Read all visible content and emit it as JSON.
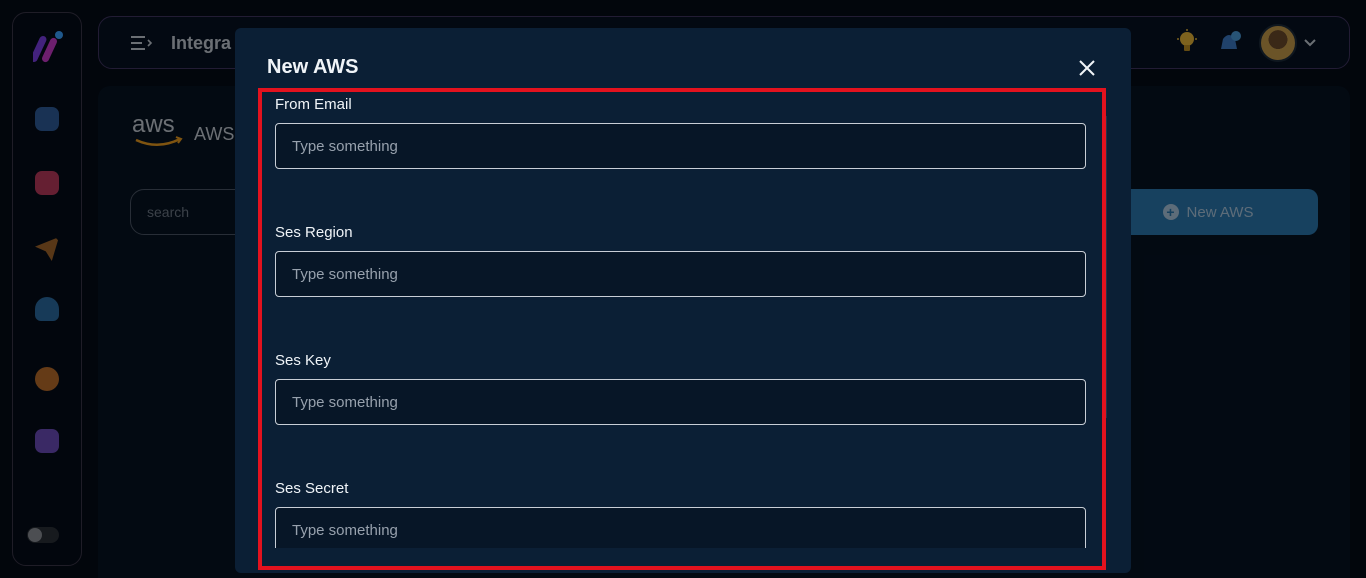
{
  "topbar": {
    "title": "Integra"
  },
  "page": {
    "brand_label": "AWS"
  },
  "search": {
    "placeholder": "search"
  },
  "actions": {
    "new_aws_label": "New AWS"
  },
  "modal": {
    "title": "New AWS",
    "fields": [
      {
        "label": "From Email",
        "placeholder": "Type something",
        "value": ""
      },
      {
        "label": "Ses Region",
        "placeholder": "Type something",
        "value": ""
      },
      {
        "label": "Ses Key",
        "placeholder": "Type something",
        "value": ""
      },
      {
        "label": "Ses Secret",
        "placeholder": "Type something",
        "value": ""
      }
    ]
  },
  "colors": {
    "accent": "#2b77ad",
    "highlight": "#e3121e",
    "modal_bg": "#0b1f35",
    "app_bg": "#040c17"
  },
  "icons": [
    "logo-icon",
    "menu-icon",
    "bulb-icon",
    "bell-icon",
    "chevron-down-icon",
    "plus-icon",
    "close-icon",
    "aws-logo"
  ]
}
